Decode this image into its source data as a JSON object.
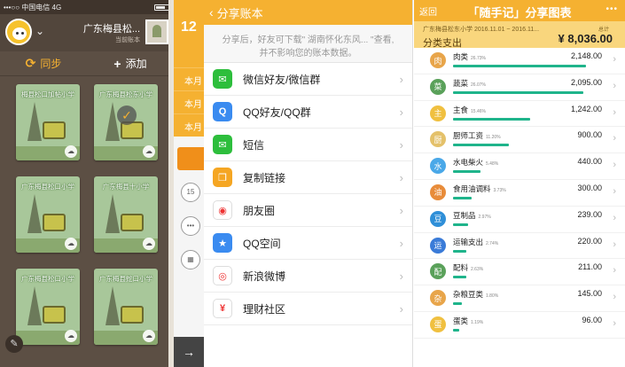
{
  "panel1": {
    "status": {
      "carrier": "•••○○ 中国电信  4G",
      "time": ""
    },
    "account_name": "广东梅县松...",
    "account_sub": "当前账本",
    "sync_label": "同步",
    "add_label": "添加",
    "books": [
      {
        "title": "梅县松口加帖小学"
      },
      {
        "title": "广东梅县松东小学"
      },
      {
        "title": "广东梅县松口小学"
      },
      {
        "title": "广东梅县十小学"
      },
      {
        "title": "广东梅县松口小学"
      },
      {
        "title": "广东梅县蛇口小学"
      }
    ]
  },
  "panel2": {
    "top": "12",
    "months": [
      "本月",
      "本月",
      "本月"
    ],
    "side_icons": [
      "15",
      "•••",
      "▦"
    ],
    "bottom": "→"
  },
  "panel3": {
    "title": "分享账本",
    "description": "分享后，好友可下载\" 湖南怀化东风... \"查看, 并不影响您的账本数据。",
    "items": [
      {
        "label": "微信好友/微信群",
        "icon": "wechat-icon",
        "color": "#2dbe3c",
        "glyph": "✉"
      },
      {
        "label": "QQ好友/QQ群",
        "icon": "qq-icon",
        "color": "#3a8bf0",
        "glyph": "Q"
      },
      {
        "label": "短信",
        "icon": "sms-icon",
        "color": "#2dbe3c",
        "glyph": "✉"
      },
      {
        "label": "复制链接",
        "icon": "copy-link-icon",
        "color": "#f5a623",
        "glyph": "❐"
      },
      {
        "label": "朋友圈",
        "icon": "moments-icon",
        "color": "#ffffff",
        "glyph": "◉"
      },
      {
        "label": "QQ空间",
        "icon": "qzone-icon",
        "color": "#3a8bf0",
        "glyph": "★"
      },
      {
        "label": "新浪微博",
        "icon": "weibo-icon",
        "color": "#ffffff",
        "glyph": "◎"
      },
      {
        "label": "理财社区",
        "icon": "finance-community-icon",
        "color": "#ffffff",
        "glyph": "¥"
      }
    ]
  },
  "panel4": {
    "back_label": "返回",
    "title": "「随手记」分享图表",
    "more": "•••",
    "summary": {
      "subtitle": "广东梅县松东小学  2016.11.01 ~ 2016.11...",
      "label": "分类支出",
      "total_caption": "总计",
      "total": "¥ 8,036.00"
    },
    "categories": [
      {
        "name": "肉类",
        "pct": "26.73%",
        "amount": "2,148.00",
        "share": 0.267,
        "color": "#e8a54a",
        "glyph": "肉"
      },
      {
        "name": "蔬菜",
        "pct": "26.07%",
        "amount": "2,095.00",
        "share": 0.261,
        "color": "#5aa15a",
        "glyph": "菜"
      },
      {
        "name": "主食",
        "pct": "15.46%",
        "amount": "1,242.00",
        "share": 0.155,
        "color": "#f0c040",
        "glyph": "主"
      },
      {
        "name": "厨师工资",
        "pct": "11.20%",
        "amount": "900.00",
        "share": 0.112,
        "color": "#e4c16a",
        "glyph": "厨"
      },
      {
        "name": "水电柴火",
        "pct": "5.48%",
        "amount": "440.00",
        "share": 0.055,
        "color": "#4aa8e8",
        "glyph": "水"
      },
      {
        "name": "食用油调料",
        "pct": "3.73%",
        "amount": "300.00",
        "share": 0.037,
        "color": "#e88c3a",
        "glyph": "油"
      },
      {
        "name": "豆制品",
        "pct": "2.97%",
        "amount": "239.00",
        "share": 0.03,
        "color": "#2f8fd8",
        "glyph": "豆"
      },
      {
        "name": "运输支出",
        "pct": "2.74%",
        "amount": "220.00",
        "share": 0.027,
        "color": "#3a7bd8",
        "glyph": "运"
      },
      {
        "name": "配料",
        "pct": "2.63%",
        "amount": "211.00",
        "share": 0.026,
        "color": "#5aa15a",
        "glyph": "配"
      },
      {
        "name": "杂粮豆类",
        "pct": "1.80%",
        "amount": "145.00",
        "share": 0.018,
        "color": "#e8a54a",
        "glyph": "杂"
      },
      {
        "name": "蛋类",
        "pct": "1.19%",
        "amount": "96.00",
        "share": 0.012,
        "color": "#f0c040",
        "glyph": "蛋"
      }
    ]
  }
}
